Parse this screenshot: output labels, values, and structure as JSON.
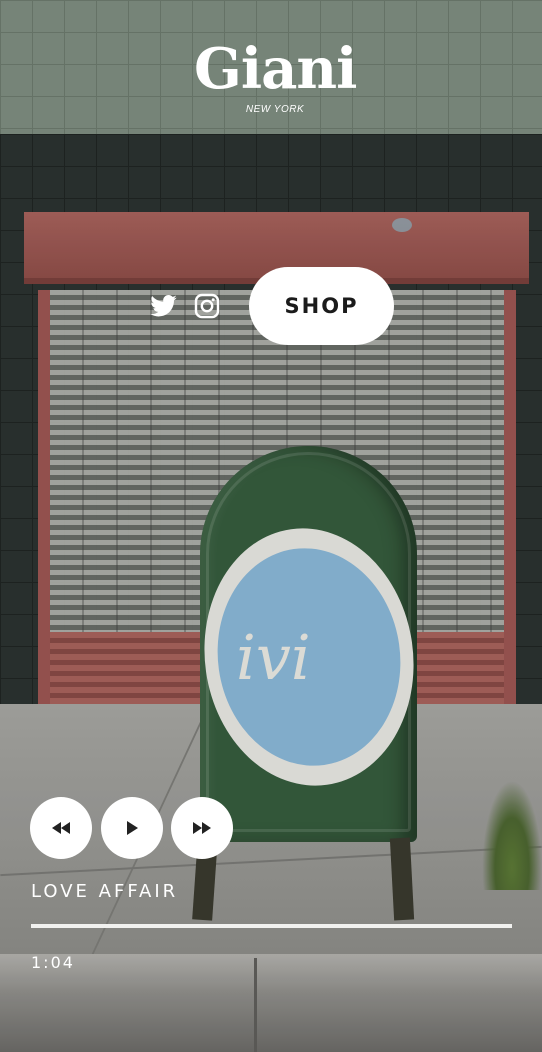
{
  "brand": {
    "name": "Giani",
    "location": "NEW YORK"
  },
  "social": {
    "twitter_icon": "twitter-icon",
    "instagram_icon": "instagram-icon"
  },
  "nav": {
    "shop_label": "SHOP"
  },
  "player": {
    "prev_icon": "rewind-icon",
    "play_icon": "play-icon",
    "next_icon": "fast-forward-icon",
    "track_title": "LOVE AFFAIR",
    "elapsed_time": "1:04",
    "progress_fraction": 1.0
  },
  "colors": {
    "button_bg": "#ffffff",
    "button_text": "#1b1b1b",
    "overlay_text": "#ffffff"
  }
}
